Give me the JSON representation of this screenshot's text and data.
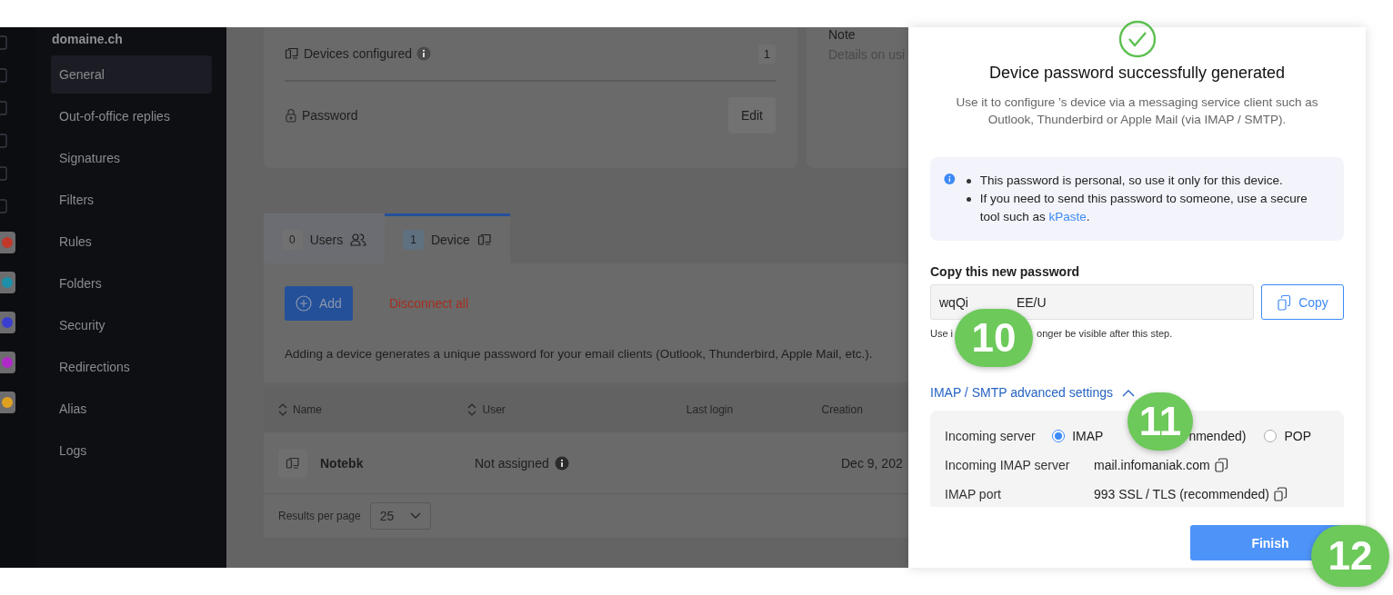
{
  "sidebar": {
    "domain": "domaine.ch",
    "items": [
      {
        "label": "General",
        "selected": true
      },
      {
        "label": "Out-of-office replies",
        "selected": false
      },
      {
        "label": "Signatures",
        "selected": false
      },
      {
        "label": "Filters",
        "selected": false
      },
      {
        "label": "Rules",
        "selected": false
      },
      {
        "label": "Folders",
        "selected": false
      },
      {
        "label": "Security",
        "selected": false
      },
      {
        "label": "Redirections",
        "selected": false
      },
      {
        "label": "Alias",
        "selected": false
      },
      {
        "label": "Logs",
        "selected": false
      }
    ]
  },
  "summary_card": {
    "devices_label": "Devices configured",
    "devices_count": "1",
    "password_label": "Password",
    "edit_button": "Edit"
  },
  "note_card": {
    "title": "Note",
    "text": "Details on usi"
  },
  "tabs": [
    {
      "count": "0",
      "label": "Users",
      "kind": "users",
      "selected": false
    },
    {
      "count": "1",
      "label": "Device",
      "kind": "device",
      "selected": true
    }
  ],
  "actions": {
    "add_button": "Add",
    "disconnect_button": "Disconnect all"
  },
  "description": "Adding a device generates a unique password for your email clients (Outlook, Thunderbird, Apple Mail, etc.).",
  "table": {
    "columns": [
      {
        "label": "Name",
        "sortable": true
      },
      {
        "label": "User",
        "sortable": true
      },
      {
        "label": "Last login",
        "sortable": false
      },
      {
        "label": "Creation",
        "sortable": false
      }
    ],
    "rows": [
      {
        "name": "Notebk",
        "user": "Not assigned",
        "creation": "Dec 9, 202"
      }
    ]
  },
  "pagination": {
    "label": "Results per page",
    "value": "25"
  },
  "dialog": {
    "title": "Device password successfully generated",
    "subtitle": "Use it to configure ’s device via a messaging service client such as Outlook, Thunderbird or Apple Mail (via IMAP / SMTP).",
    "notices": [
      {
        "text": "This password is personal, so use it only for this device."
      },
      {
        "text": "If you need to send this password to someone, use a secure tool such as ",
        "link": "kPaste",
        "after": "."
      }
    ],
    "password_label": "Copy this new password",
    "password_start": "wqQi",
    "password_end": "EE/U",
    "copy_button": "Copy",
    "hint_start": "Use i",
    "hint_end": "onger be visible after this step.",
    "advanced_link": "IMAP / SMTP advanced settings",
    "advanced_expanded": true,
    "settings": [
      {
        "kind": "radio",
        "label": "Incoming server",
        "options": [
          {
            "label": "IMAP",
            "label_end": "nmended)",
            "selected": true
          },
          {
            "label": "POP",
            "selected": false
          }
        ]
      },
      {
        "kind": "copy",
        "label": "Incoming IMAP server",
        "value": "mail.infomaniak.com"
      },
      {
        "kind": "copy",
        "label": "IMAP port",
        "value": "993 SSL / TLS (recommended)"
      }
    ],
    "finish_button": "Finish"
  },
  "step_markers": [
    "10",
    "11",
    "12"
  ]
}
